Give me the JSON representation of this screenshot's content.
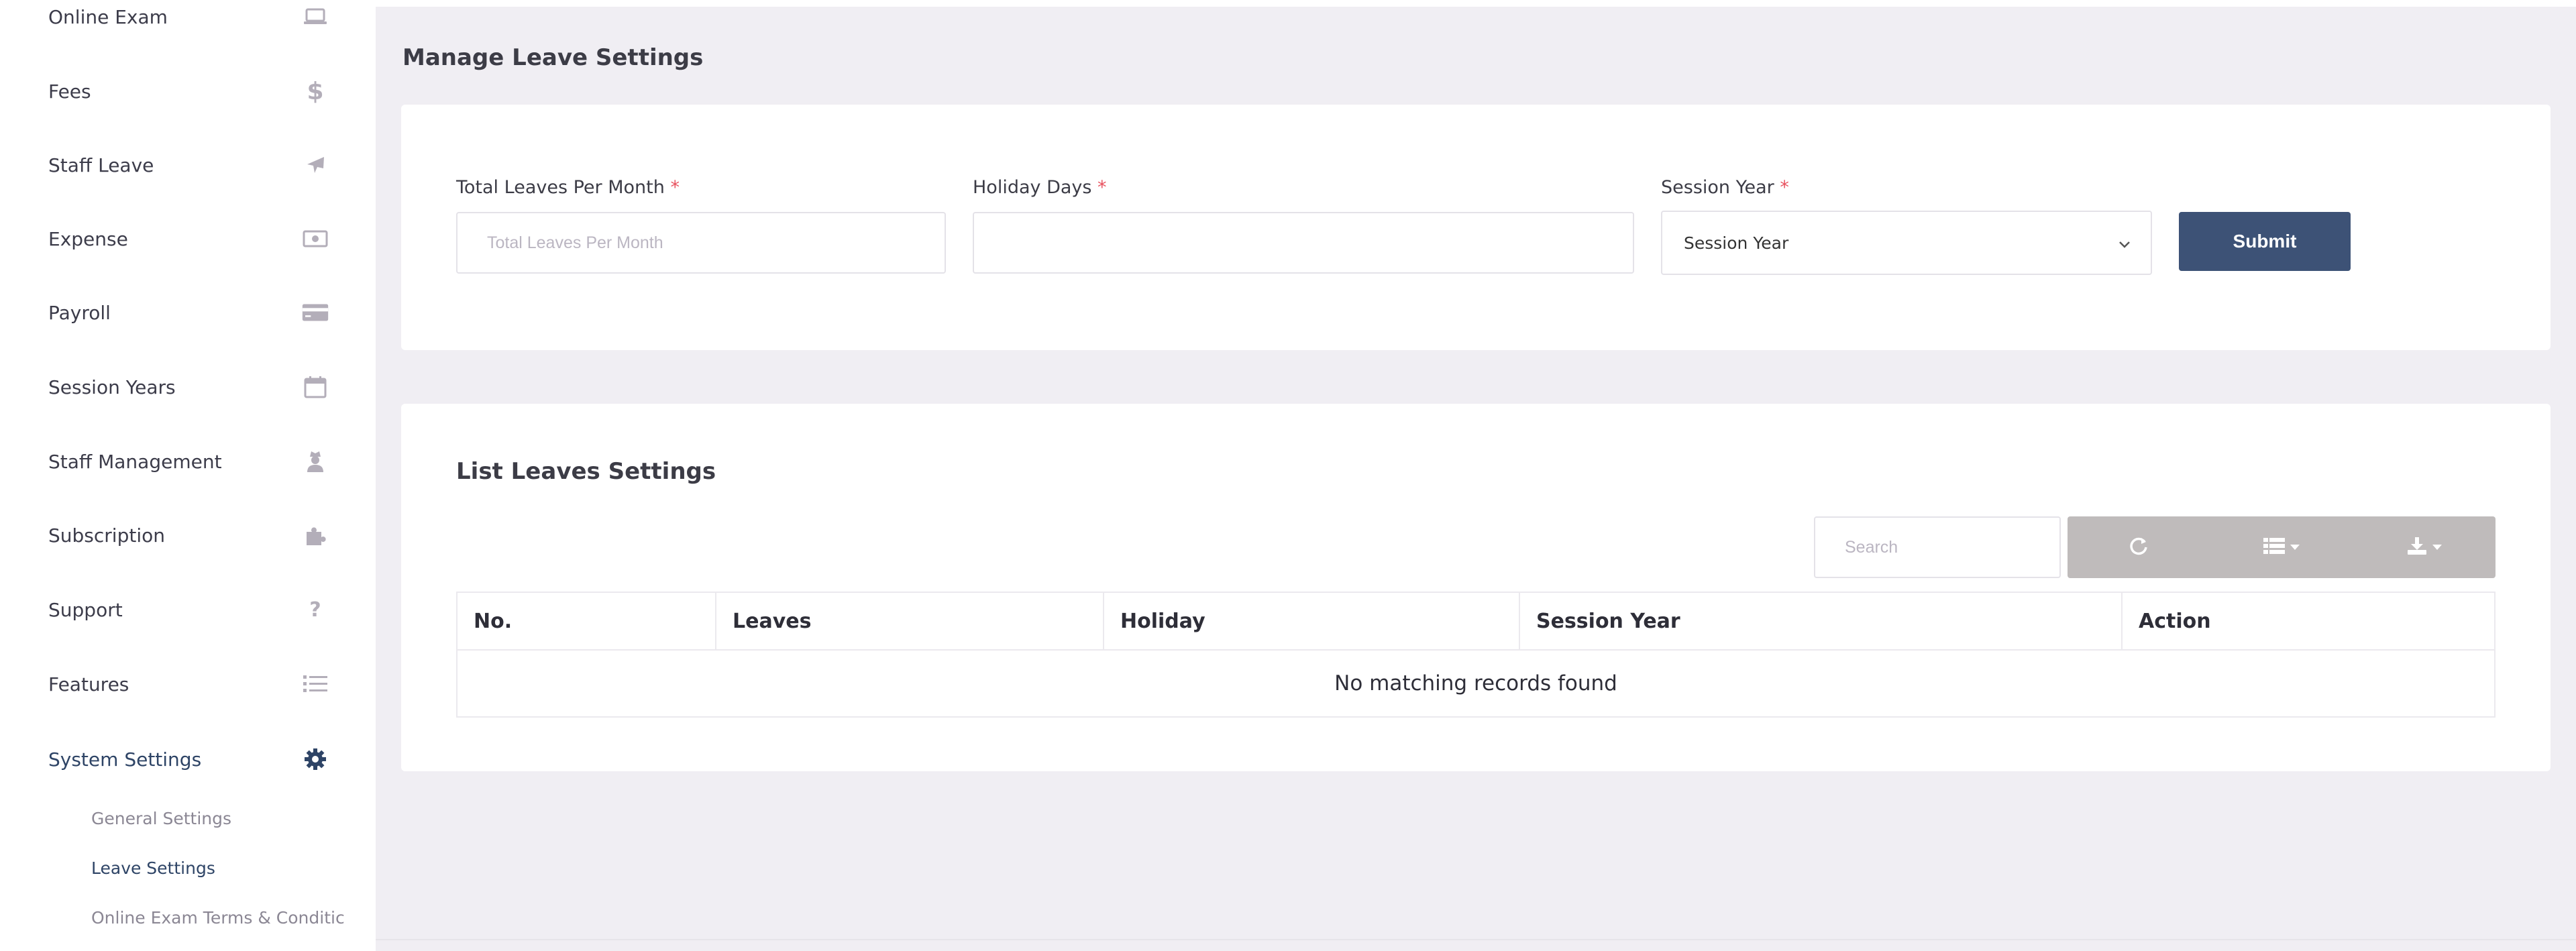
{
  "sidebar": {
    "items": [
      {
        "label": "Online Exam",
        "icon": "laptop-icon"
      },
      {
        "label": "Fees",
        "icon": "dollar-icon"
      },
      {
        "label": "Staff Leave",
        "icon": "plane-icon"
      },
      {
        "label": "Expense",
        "icon": "money-icon"
      },
      {
        "label": "Payroll",
        "icon": "credit-card-icon"
      },
      {
        "label": "Session Years",
        "icon": "calendar-icon"
      },
      {
        "label": "Staff Management",
        "icon": "user-secret-icon"
      },
      {
        "label": "Subscription",
        "icon": "puzzle-icon"
      },
      {
        "label": "Support",
        "icon": "question-icon"
      },
      {
        "label": "Features",
        "icon": "list-icon"
      },
      {
        "label": "System Settings",
        "icon": "gear-icon",
        "active": true
      }
    ],
    "subitems": [
      {
        "label": "General Settings"
      },
      {
        "label": "Leave Settings",
        "active": true
      },
      {
        "label": "Online Exam Terms & Conditic"
      }
    ]
  },
  "page": {
    "title": "Manage Leave Settings"
  },
  "form": {
    "total_leaves_label": "Total Leaves Per Month",
    "total_leaves_placeholder": "Total Leaves Per Month",
    "total_leaves_value": "",
    "holiday_days_label": "Holiday Days",
    "holiday_days_value": "",
    "session_year_label": "Session Year",
    "session_year_selected": "Session Year",
    "required_mark": "*",
    "submit_label": "Submit"
  },
  "list": {
    "title": "List Leaves Settings",
    "search_placeholder": "Search",
    "columns": [
      "No.",
      "Leaves",
      "Holiday",
      "Session Year",
      "Action"
    ],
    "empty_message": "No matching records found"
  },
  "colors": {
    "accent": "#3d5276",
    "background": "#f0eef3",
    "toolbar": "#bfbbbb",
    "required": "#e8525f"
  }
}
